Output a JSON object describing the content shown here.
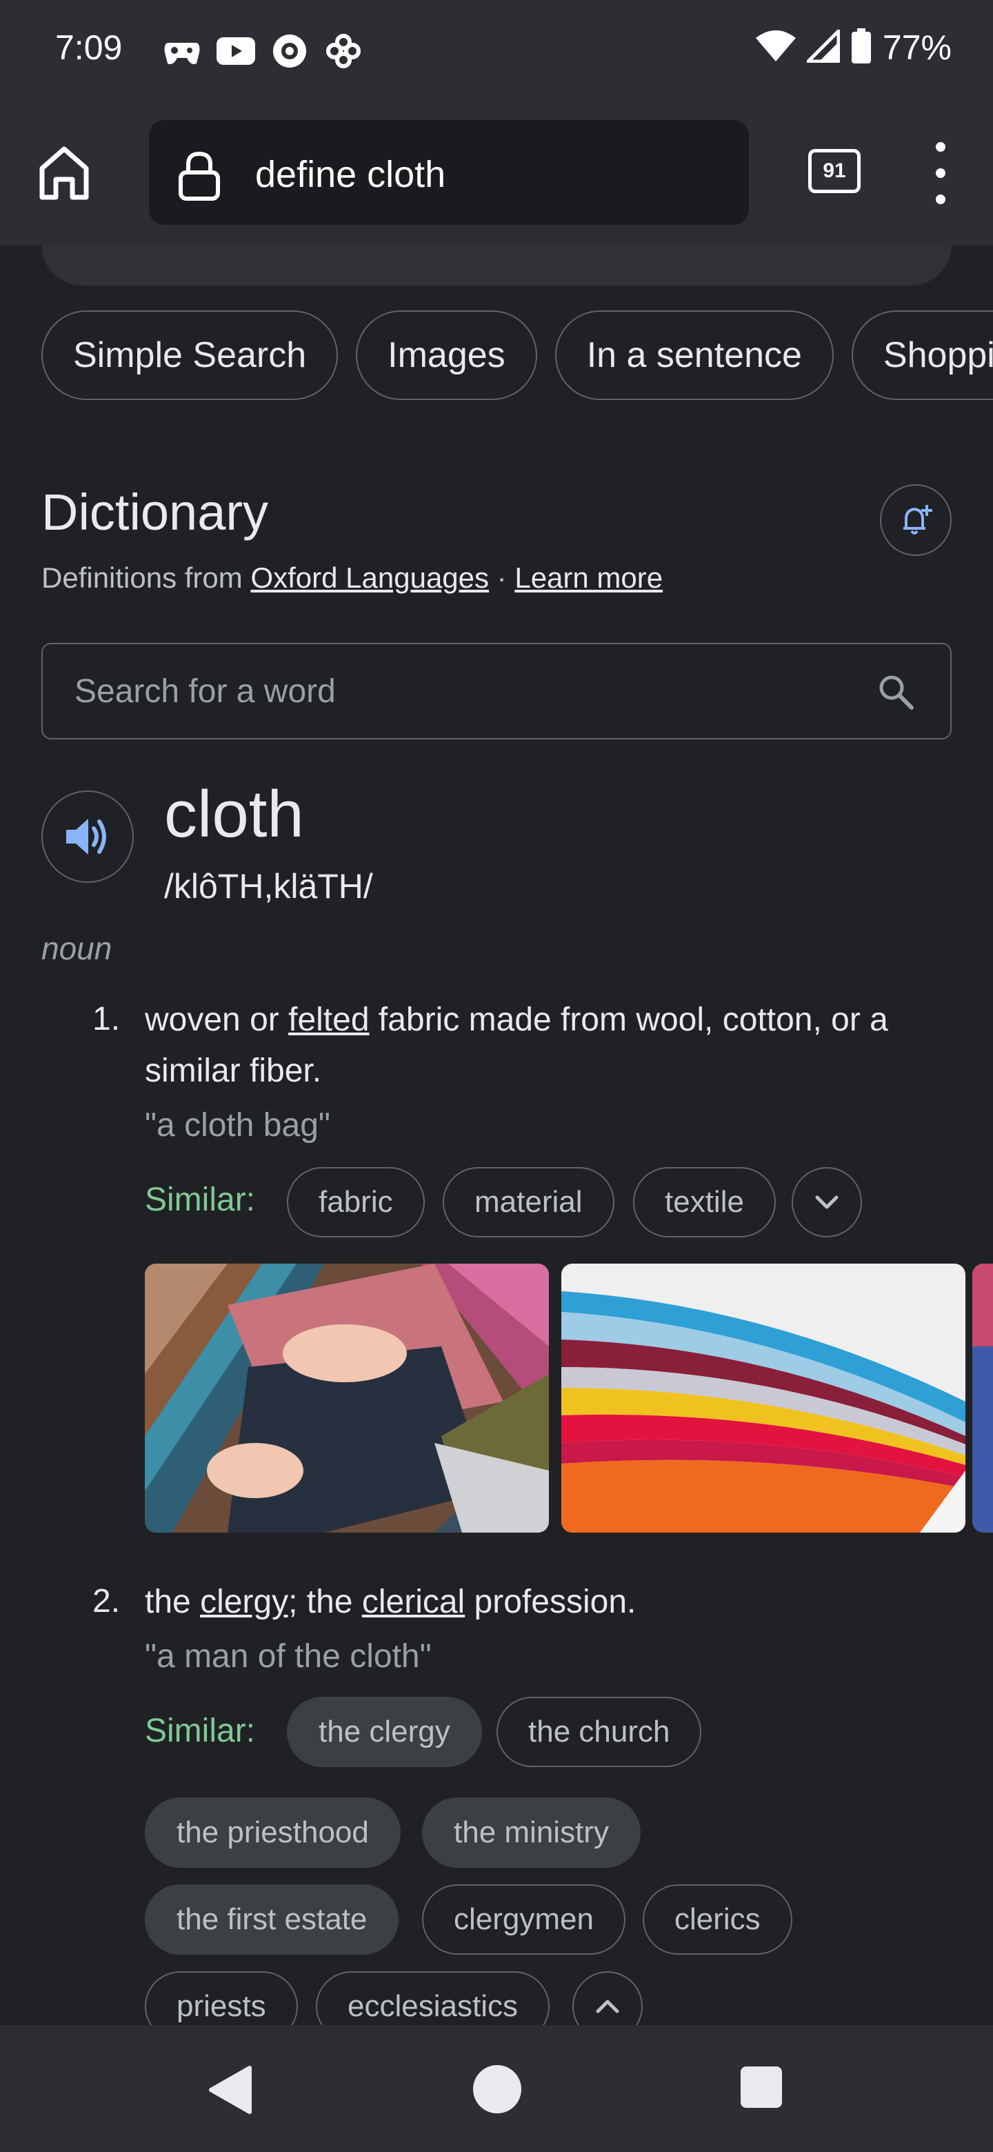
{
  "status_bar": {
    "time": "7:09",
    "battery": "77%",
    "left_icons": [
      "game-controller-icon",
      "youtube-icon",
      "messenger-icon",
      "pinwheel-icon"
    ],
    "right_icons": [
      "wifi-icon",
      "signal-icon",
      "battery-icon"
    ]
  },
  "toolbar": {
    "url_text": "define cloth",
    "tab_count": "91"
  },
  "chips": [
    "Simple Search",
    "Images",
    "In a sentence",
    "Shopping"
  ],
  "dictionary": {
    "title": "Dictionary",
    "source_prefix": "Definitions from ",
    "source_link": "Oxford Languages",
    "separator": " · ",
    "learn_more": "Learn more",
    "search_placeholder": "Search for a word",
    "word": "cloth",
    "phonetic": "/klôTH,kläTH/",
    "part_of_speech": "noun",
    "senses": [
      {
        "number": "1.",
        "def_before": "woven or ",
        "def_link": "felted",
        "def_after": " fabric made from wool, cotton, or a similar fiber.",
        "example": "\"a cloth bag\"",
        "similar_label": "Similar:",
        "similar": [
          "fabric",
          "material",
          "textile"
        ]
      },
      {
        "number": "2.",
        "def_part1": "the ",
        "def_link1": "clergy;",
        "def_part2": " the ",
        "def_link2": "clerical",
        "def_part3": " profession.",
        "example": "\"a man of the cloth\"",
        "similar_label": "Similar:",
        "similar": [
          "the clergy",
          "the church",
          "the priesthood",
          "the ministry",
          "the first estate",
          "clergymen",
          "clerics",
          "priests",
          "ecclesiastics"
        ]
      }
    ]
  },
  "colors": {
    "background": "#202124",
    "bar": "#2d2e33",
    "similar_label": "#81c995",
    "accent_blue": "#8ab4f8"
  }
}
